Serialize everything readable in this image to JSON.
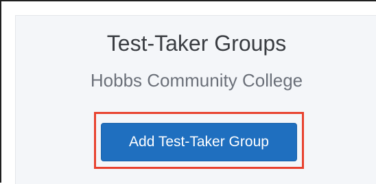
{
  "page": {
    "title": "Test-Taker Groups",
    "subtitle": "Hobbs Community College"
  },
  "actions": {
    "add_group_label": "Add Test-Taker Group"
  },
  "colors": {
    "button_background": "#1f6fbf",
    "highlight_border": "#e8412e",
    "panel_background": "#f4f6f9"
  }
}
